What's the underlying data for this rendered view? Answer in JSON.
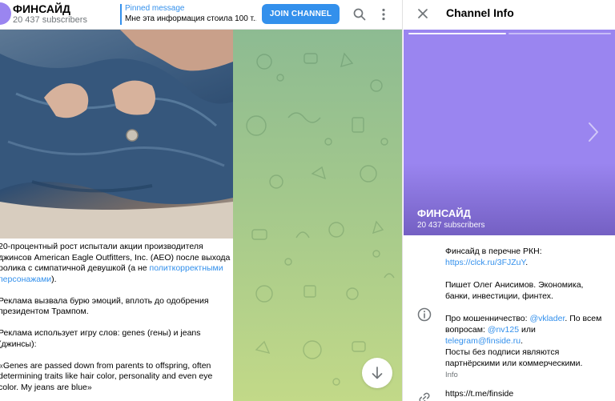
{
  "channel": {
    "name": "ФИНСАЙД",
    "subscribers": "20 437 subscribers"
  },
  "pinned": {
    "label": "Pinned message",
    "text": "Мне эта информация стоила 100 т..."
  },
  "toolbar": {
    "join_label": "JOIN CHANNEL",
    "search_icon": "search-icon",
    "menu_icon": "more-vertical-icon"
  },
  "post": {
    "p1_before": "20-процентный рост испытали акции производителя джинсов American Eagle Outfitters, Inc. (AEO) после выхода ролика с симпатичной девушкой (а не ",
    "p1_link": "политкорректными персонажами",
    "p1_after": ").",
    "p2": "Реклама вызвала бурю эмоций, вплоть до одобрения президентом Трампом.",
    "p3": "Реклама использует игру слов: genes (гены) и jeans (джинсы):",
    "p4": "«Genes are passed down from parents to offspring, often determining traits like hair color, personality and even eye color. My jeans are blue»"
  },
  "panel": {
    "title": "Channel Info",
    "close_icon": "close-icon",
    "cover_name": "ФИНСАЙД",
    "cover_subs": "20 437 subscribers",
    "info": {
      "line1_prefix": "Финсайд в перечне РКН: ",
      "line1_link": "https://clck.ru/3FJZuY",
      "line1_suffix": ".",
      "line2": "Пишет Олег Анисимов. Экономика, банки, инвестиции, финтех.",
      "line3_a": "Про мошенничество: ",
      "line3_link1": "@vklader",
      "line3_b": ". По всем вопросам: ",
      "line3_link2": "@nv125",
      "line3_c": " или ",
      "line3_link3": "telegram@finside.ru",
      "line3_d": ".",
      "line4": "Посты без подписи являются партнёрскими или коммерческими.",
      "caption": "Info"
    },
    "link": "https://t.me/finside"
  },
  "colors": {
    "accent": "#3390ec",
    "cover": "#9a85f0"
  }
}
